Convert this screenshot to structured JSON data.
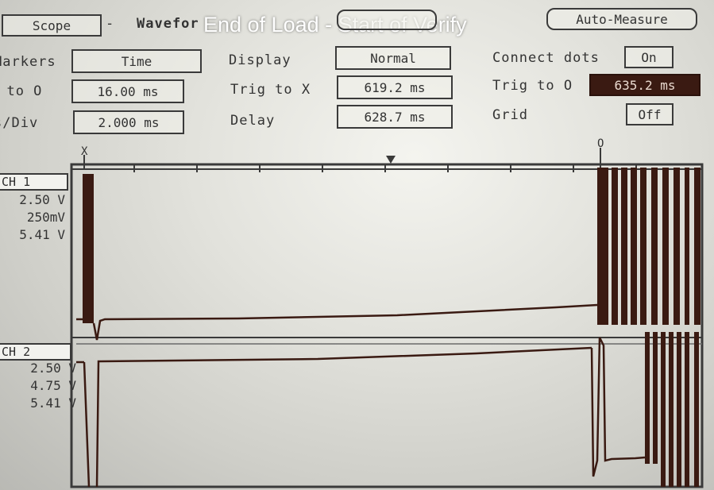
{
  "header": {
    "scope_button": "Scope",
    "dash": "-",
    "waveform_label": "Wavefor",
    "overlay_title": "End of Load - Start of Verify",
    "auto_measure_button": "Auto-Measure"
  },
  "controls": {
    "markers": {
      "label": "Markers",
      "value": "Time"
    },
    "x_to_o": {
      "label": "X to O",
      "value": "16.00 ms"
    },
    "time_per_div": {
      "label": "s/Div",
      "value": "2.000 ms"
    },
    "display": {
      "label": "Display",
      "value": "Normal"
    },
    "trig_to_x": {
      "label": "Trig to X",
      "value": "619.2 ms"
    },
    "delay": {
      "label": "Delay",
      "value": "628.7 ms"
    },
    "connect_dots": {
      "label": "Connect dots",
      "value": "On"
    },
    "trig_to_o": {
      "label": "Trig to O",
      "value": "635.2 ms"
    },
    "grid": {
      "label": "Grid",
      "value": "Off"
    }
  },
  "markers": {
    "x": "X",
    "o": "O",
    "trigger": "T"
  },
  "channels": [
    {
      "name": "CH 1",
      "scale": "2.50 V",
      "marker_x": "250mV",
      "marker_o": "5.41 V"
    },
    {
      "name": "CH 2",
      "scale": "2.50 V",
      "marker_x": "4.75 V",
      "marker_o": "5.41 V"
    }
  ],
  "colors": {
    "trace": "#3a1a12",
    "frame": "#3a3a3a",
    "dark_box": "#3a1a12"
  }
}
